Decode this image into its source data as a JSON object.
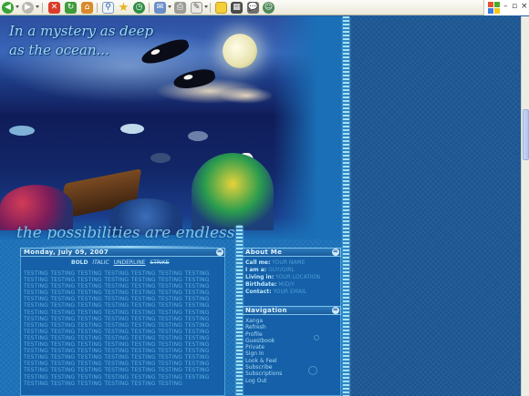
{
  "browser": {
    "toolbar_icons": [
      "back-icon",
      "forward-icon",
      "stop-icon",
      "refresh-icon",
      "home-icon",
      "search-icon",
      "favorites-icon",
      "history-icon",
      "mail-icon",
      "print-icon",
      "edit-icon",
      "messenger-icon",
      "media-icon",
      "discuss-icon",
      "research-icon"
    ],
    "window_controls": {
      "minimize": "–",
      "maximize": "▫",
      "close": "×"
    }
  },
  "header": {
    "tagline_top": "In a mystery as deep as the ocean...",
    "tagline_bottom": "the possibilities are endless"
  },
  "post": {
    "date": "Monday, July 09, 2007",
    "formatting": {
      "bold": "BOLD",
      "italic": "ITALIC",
      "underline": "UNDERLINE",
      "strike": "STRIKE"
    },
    "body": "TESTING TESTING TESTING TESTING TESTING TESTING TESTING TESTING TESTING TESTING TESTING TESTING TESTING TESTING TESTING TESTING TESTING TESTING TESTING TESTING TESTING TESTING TESTING TESTING TESTING TESTING TESTING TESTING TESTING TESTING TESTING TESTING TESTING TESTING TESTING TESTING TESTING TESTING TESTING TESTING TESTING TESTING TESTING TESTING TESTING TESTING TESTING TESTING TESTING TESTING TESTING TESTING TESTING TESTING TESTING TESTING TESTING TESTING TESTING TESTING TESTING TESTING TESTING TESTING TESTING TESTING TESTING TESTING TESTING TESTING TESTING TESTING TESTING TESTING TESTING TESTING TESTING TESTING TESTING TESTING TESTING TESTING TESTING TESTING TESTING TESTING TESTING TESTING TESTING TESTING TESTING TESTING TESTING TESTING TESTING TESTING TESTING TESTING TESTING TESTING TESTING TESTING TESTING TESTING TESTING TESTING TESTING TESTING TESTING TESTING TESTING TESTING TESTING TESTING TESTING TESTING TESTING TESTING TESTING TESTING TESTING TESTING TESTING TESTING TESTING"
  },
  "about": {
    "title": "About Me",
    "rows": [
      {
        "key": "Call me:",
        "value": "YOUR NAME"
      },
      {
        "key": "I am a:",
        "value": "GUY/GIRL"
      },
      {
        "key": "Living in:",
        "value": "YOUR LOCATION"
      },
      {
        "key": "Birthdate:",
        "value": "M/D/Y"
      },
      {
        "key": "Contact:",
        "value": "YOUR EMAIL"
      }
    ]
  },
  "navigation": {
    "title": "Navigation",
    "links": [
      "Xanga",
      "Refresh",
      "Profile",
      "Guestbook",
      "Private",
      "Sign In",
      "Look & Feel",
      "Subscribe",
      "Subscriptions",
      "Log Out"
    ]
  },
  "colors": {
    "page_background": "#1c5692",
    "content_background": "#1a6fb6",
    "panel_border": "#7fc3ea",
    "text_light": "#bfe9fd",
    "text_muted": "#4c9fd8"
  }
}
